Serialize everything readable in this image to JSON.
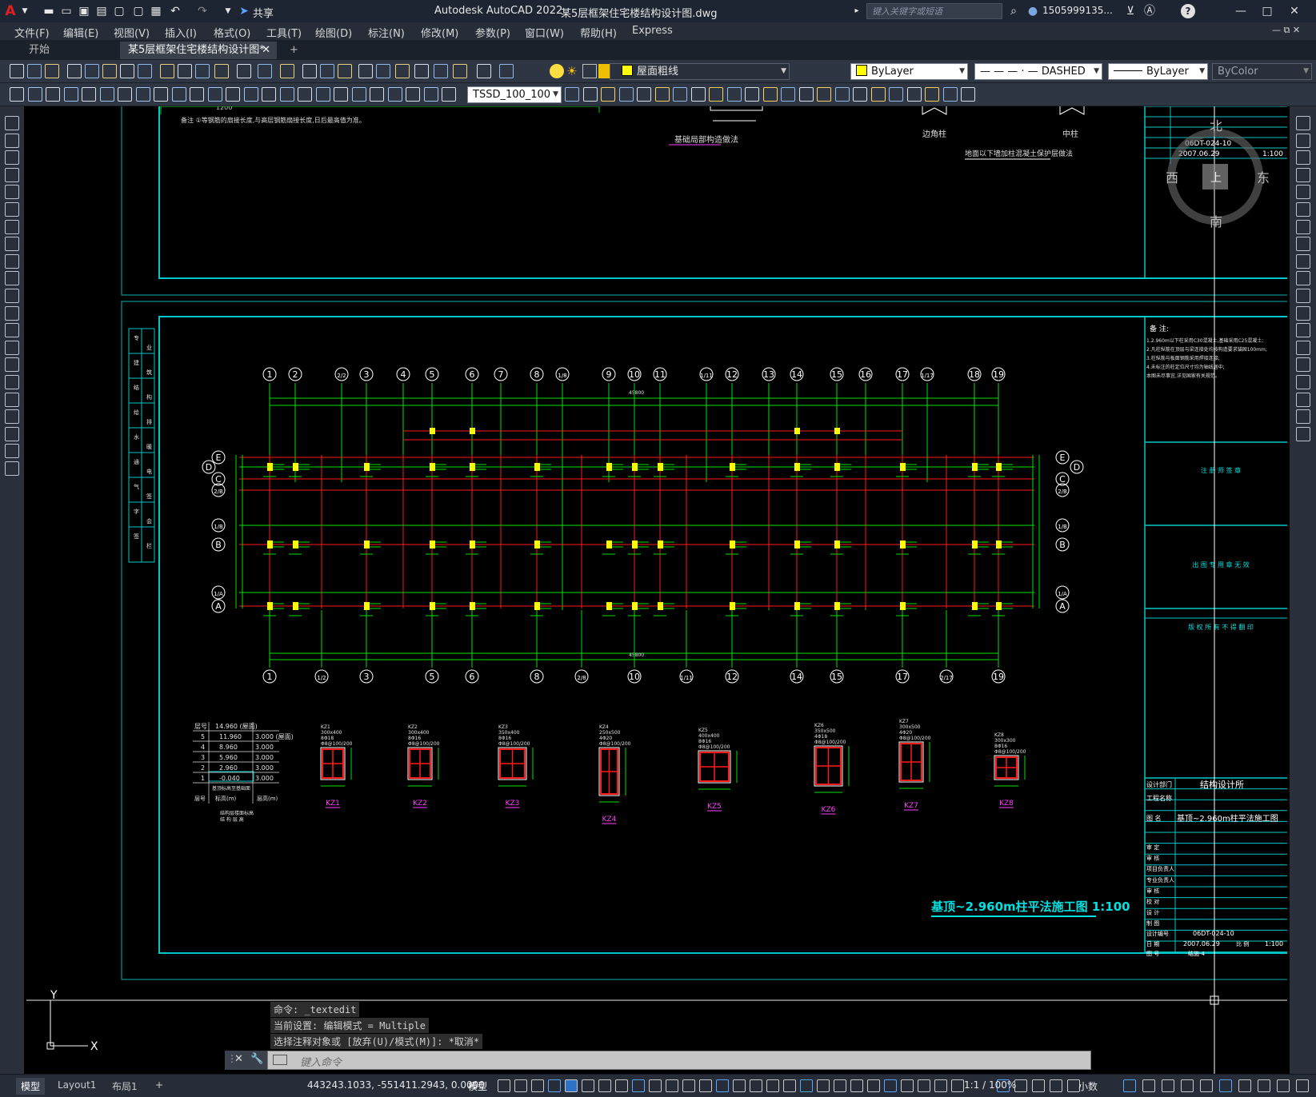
{
  "titlebar": {
    "app_logo": "A",
    "app_title": "Autodesk AutoCAD 2022",
    "file_title": "某5层框架住宅楼结构设计图.dwg",
    "share_label": "共享",
    "search_placeholder": "键入关键字或短语",
    "user": "1505999135...",
    "help": "?"
  },
  "menubar": {
    "items": [
      "文件(F)",
      "编辑(E)",
      "视图(V)",
      "插入(I)",
      "格式(O)",
      "工具(T)",
      "绘图(D)",
      "标注(N)",
      "修改(M)",
      "参数(P)",
      "窗口(W)",
      "帮助(H)",
      "Express"
    ]
  },
  "tabs": {
    "start": "开始",
    "doc": "某5层框架住宅楼结构设计图*",
    "add": "+"
  },
  "toolbar": {
    "layer": "屋面粗线",
    "color": "ByLayer",
    "linetype_preview": "— — — · —",
    "linetype": "DASHED",
    "lineweight": "ByLayer",
    "plotstyle": "ByColor",
    "textstyle": "TSSD_100_100"
  },
  "colors": {
    "accent_yellow": "#ffff00",
    "frame_cyan": "#00c8c8",
    "axis_green": "#00e000",
    "beam_red": "#ff1a1a",
    "annot_magenta": "#ff40ff"
  },
  "drawing": {
    "top_sheet": {
      "note": "备注 ①等钢筋的扇接长度,与高层钢筋扇接长度,日后最高值为准。",
      "label_base": "基础局部构造做法",
      "label_corner": "边角柱",
      "label_middle": "中柱",
      "label_wall": "地面以下墙加柱混凝土保护层做法",
      "tb_code": "06DT-024-10",
      "tb_date": "2007.06.29",
      "tb_scale": "1:100"
    },
    "compass": {
      "north": "北",
      "south": "南",
      "east": "东",
      "west": "西",
      "center": "上"
    },
    "top_axes": [
      "1",
      "2",
      "2/2",
      "3",
      "4",
      "5",
      "6",
      "7",
      "8",
      "1/8",
      "9",
      "10",
      "11",
      "1/11",
      "12",
      "13",
      "14",
      "15",
      "16",
      "17",
      "1/17",
      "18",
      "19"
    ],
    "bottom_axes": [
      "1",
      "1/2",
      "3",
      "5",
      "6",
      "8",
      "2/8",
      "10",
      "1/11",
      "12",
      "14",
      "15",
      "17",
      "2/17",
      "19"
    ],
    "left_axes": [
      "E",
      "D",
      "C",
      "2/B",
      "1/B",
      "B",
      "1/A",
      "A"
    ],
    "right_axes": [
      "E",
      "D",
      "C",
      "2/B",
      "1/B",
      "B",
      "1/A",
      "A"
    ],
    "overall_dim": "45800",
    "floor_table": {
      "header": [
        "层号",
        "标高(m)",
        "层高(m)"
      ],
      "roof": "14.960 (屋面)",
      "rows": [
        [
          "5",
          "11.960",
          "3.000 (屋面)"
        ],
        [
          "4",
          "8.960",
          "3.000"
        ],
        [
          "3",
          "5.960",
          "3.000"
        ],
        [
          "2",
          "2.960",
          "3.000"
        ],
        [
          "1",
          "-0.040",
          "3.000"
        ]
      ],
      "caption1": "基顶标高至基础面",
      "caption2": "结构层楼面标高",
      "caption3": "结 构 层 高"
    },
    "columns": [
      {
        "name": "KZ1",
        "size": "300x400",
        "bars": "8Φ18",
        "stirrup": "Φ8@100/200"
      },
      {
        "name": "KZ2",
        "size": "300x400",
        "bars": "8Φ16",
        "stirrup": "Φ8@100/200"
      },
      {
        "name": "KZ3",
        "size": "350x400",
        "bars": "8Φ16",
        "stirrup": "Φ8@100/200"
      },
      {
        "name": "KZ4",
        "size": "250x500",
        "bars": "4Φ20",
        "stirrup": "Φ8@100/200"
      },
      {
        "name": "KZ5",
        "size": "400x400",
        "bars": "8Φ16",
        "stirrup": "Φ8@100/200"
      },
      {
        "name": "KZ6",
        "size": "350x500",
        "bars": "4Φ18",
        "stirrup": "Φ8@100/200"
      },
      {
        "name": "KZ7",
        "size": "300x500",
        "bars": "4Φ20",
        "stirrup": "Φ8@100/200"
      },
      {
        "name": "KZ8",
        "size": "300x300",
        "bars": "8Φ16",
        "stirrup": "Φ8@100/200"
      }
    ],
    "plan_title": "基顶~2.960m柱平法施工图 1:100",
    "notes_title": "备 注:",
    "notes": [
      "1.2.960m以下柱采用C30混凝土,基础采用C25混凝土;",
      "2.凡柱纵筋在顶层与梁连接处均按构造要求锚固100mm;",
      "3.柱纵筋与板面钢筋采用焊接连接;",
      "4.未标注的柱定位尺寸均为轴线居中;",
      "本图未尽事宜,详见国家有关规范。"
    ],
    "stamp_note1": "注 册 师 签 章",
    "stamp_note2": "出 图 专 用 章 无 效",
    "stamp_note3": "版 权 所 有 不 得 翻 印",
    "tb_dept_label": "设计部门",
    "tb_dept": "结构设计所",
    "tb_project_label": "工程名称",
    "tb_drawing_label": "图 名",
    "tb_drawing": "基顶~2.960m柱平法施工图",
    "tb_rows": [
      "审 定",
      "审 核",
      "项目负责人",
      "专业负责人",
      "审 核",
      "校 对",
      "设 计",
      "制 图"
    ],
    "tb_code_label": "设计编号",
    "tb_code": "06DT-024-10",
    "tb_date_label": "日 期",
    "tb_date": "2007.06.29",
    "tb_scale_label": "比 例",
    "tb_scale": "1:100",
    "tb_sheet_label": "图 号",
    "tb_sheet": "结施-4",
    "left_strip": [
      "专",
      "业",
      "建",
      "筑",
      "结",
      "构",
      "给",
      "排",
      "水",
      "暖",
      "通",
      "电",
      "气",
      "签",
      "字",
      "会",
      "签",
      "栏"
    ]
  },
  "ucs": {
    "x": "X",
    "y": "Y"
  },
  "command": {
    "history": [
      "命令: _textedit",
      "当前设置: 编辑模式 = Multiple",
      "选择注释对象或 [放弃(U)/模式(M)]: *取消*"
    ],
    "placeholder": "键入命令"
  },
  "statusbar": {
    "tabs": [
      "模型",
      "Layout1",
      "布局1"
    ],
    "add": "+",
    "coords": "443243.1033, -551411.2943, 0.0000",
    "model": "模型",
    "scale": "1:1 / 100%",
    "units": "小数"
  }
}
